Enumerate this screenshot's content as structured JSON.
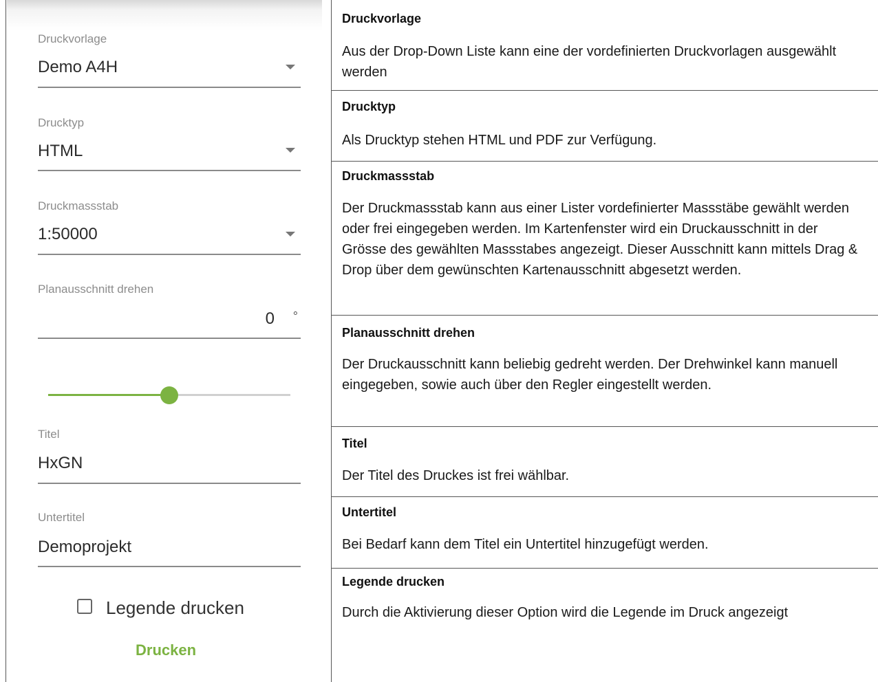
{
  "form": {
    "template": {
      "label": "Druckvorlage",
      "value": "Demo A4H"
    },
    "print_type": {
      "label": "Drucktyp",
      "value": "HTML"
    },
    "scale": {
      "label": "Druckmassstab",
      "value": "1:50000"
    },
    "rotation": {
      "label": "Planausschnitt drehen",
      "value": "0",
      "unit": "°",
      "slider_fraction": 0.5
    },
    "title": {
      "label": "Titel",
      "value": "HxGN"
    },
    "subtitle": {
      "label": "Untertitel",
      "value": "Demoprojekt"
    },
    "legend": {
      "label": "Legende drucken",
      "checked": false
    },
    "print_label": "Drucken"
  },
  "accent_color": "#7cb342",
  "help": [
    {
      "heading": "Druckvorlage",
      "text": "Aus der Drop-Down Liste kann eine der vordefinierten Druckvorlagen ausgewählt werden"
    },
    {
      "heading": "Drucktyp",
      "text": "Als Drucktyp stehen HTML und PDF zur Verfügung."
    },
    {
      "heading": "Druckmassstab",
      "text": "Der Druckmassstab kann aus einer Lister vordefinierter Massstäbe gewählt werden oder frei eingegeben werden. Im Kartenfenster wird ein Druckausschnitt in der Grösse des gewählten Massstabes angezeigt. Dieser Ausschnitt kann mittels Drag & Drop über dem gewünschten Kartenausschnitt abgesetzt werden."
    },
    {
      "heading": "Planausschnitt drehen",
      "text": "Der Druckausschnitt kann beliebig gedreht werden. Der Drehwinkel kann manuell eingegeben, sowie auch über den Regler eingestellt werden."
    },
    {
      "heading": "Titel",
      "text": "Der Titel des Druckes ist frei wählbar."
    },
    {
      "heading": "Untertitel",
      "text": "Bei Bedarf kann dem Titel ein Untertitel hinzugefügt werden."
    },
    {
      "heading": "Legende drucken",
      "text": "Durch die Aktivierung dieser Option wird die Legende im Druck angezeigt"
    }
  ]
}
